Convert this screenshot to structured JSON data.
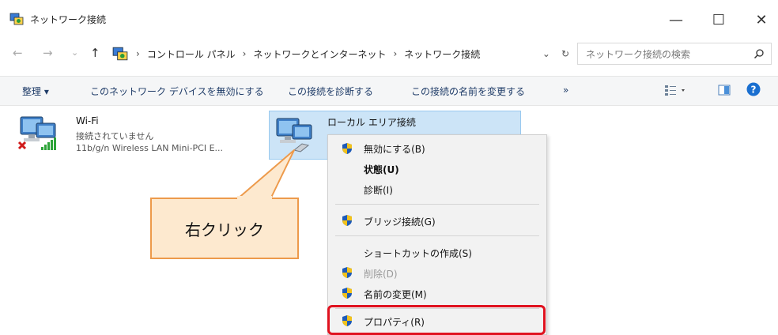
{
  "window": {
    "title": "ネットワーク接続",
    "controls": {
      "minimize": "—",
      "maximize": "☐",
      "close": "✕"
    }
  },
  "nav": {
    "back": "←",
    "forward": "→",
    "recent": "⌄",
    "up": "↑"
  },
  "breadcrumb": {
    "items": [
      "コントロール パネル",
      "ネットワークとインターネット",
      "ネットワーク接続"
    ],
    "separator": "›",
    "dropdown": "⌄",
    "refresh": "↻"
  },
  "search": {
    "placeholder": "ネットワーク接続の検索"
  },
  "toolbar": {
    "organize": "整理 ▾",
    "disable": "このネットワーク デバイスを無効にする",
    "diagnose": "この接続を診断する",
    "rename": "この接続の名前を変更する",
    "more": "»"
  },
  "connections": [
    {
      "name": "Wi-Fi",
      "status": "接続されていません",
      "adapter": "11b/g/n  Wireless LAN Mini-PCI E..."
    },
    {
      "name": "ローカル エリア接続"
    }
  ],
  "context_menu": {
    "items": [
      {
        "label": "無効にする(B)",
        "shield": true
      },
      {
        "label": "状態(U)",
        "bold": true
      },
      {
        "label": "診断(I)"
      },
      {
        "label": "ブリッジ接続(G)",
        "shield": true
      },
      {
        "label": "ショートカットの作成(S)"
      },
      {
        "label": "削除(D)",
        "shield": true,
        "disabled": true
      },
      {
        "label": "名前の変更(M)",
        "shield": true
      },
      {
        "label": "プロパティ(R)",
        "shield": true,
        "highlighted": true
      }
    ]
  },
  "callout": {
    "text": "右クリック"
  },
  "colors": {
    "highlight": "#e0121f",
    "callout_fill": "#fde9cf",
    "callout_border": "#ed9a4b",
    "selection": "#cce4f7"
  }
}
